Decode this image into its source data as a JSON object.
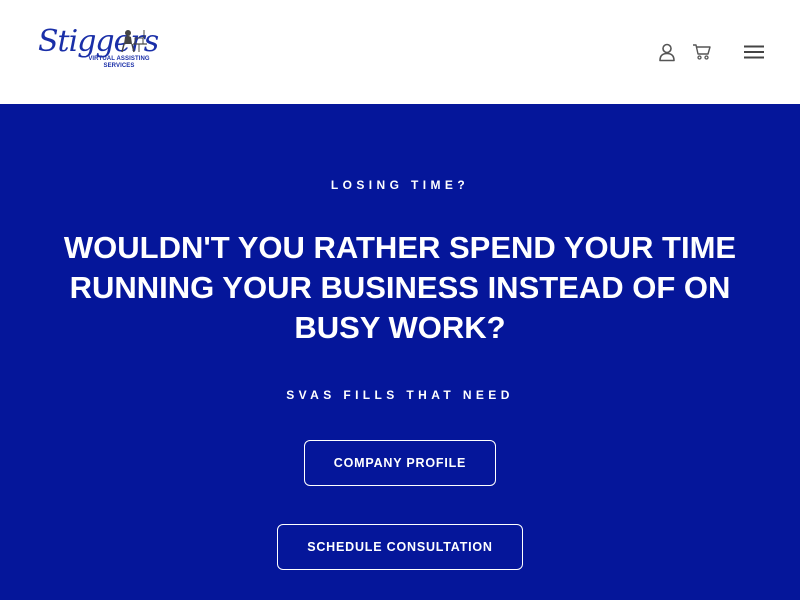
{
  "header": {
    "logo": {
      "script": "Stiggers",
      "subtitle": "VIRTUAL ASSISTING SERVICES"
    },
    "icons": {
      "account": "user-icon",
      "cart": "cart-icon",
      "menu": "hamburger-menu-icon"
    }
  },
  "hero": {
    "eyebrow": "LOSING TIME?",
    "headline": "WOULDN'T YOU RATHER SPEND YOUR TIME RUNNING YOUR BUSINESS INSTEAD OF ON BUSY WORK?",
    "subline": "SVAS FILLS THAT NEED",
    "buttons": {
      "profile": "COMPANY PROFILE",
      "consultation": "SCHEDULE CONSULTATION"
    }
  },
  "colors": {
    "hero_background": "#05169a",
    "brand_blue": "#1a2fa8",
    "header_background": "#ffffff",
    "text_on_hero": "#ffffff"
  }
}
